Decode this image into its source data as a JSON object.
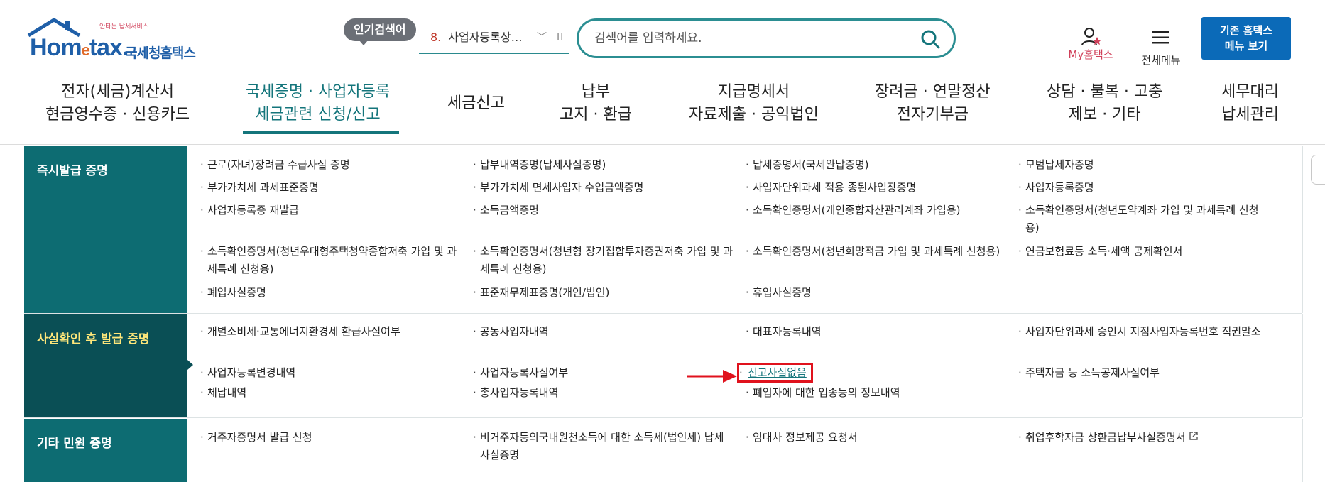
{
  "header": {
    "logo": {
      "text_en": "Hom",
      "text_e": "e",
      "text_tax": "tax.",
      "text_ko": "국세청홈택스",
      "tagline": "안타는 납세서비스"
    },
    "popular_search": {
      "badge": "인기검색어",
      "rank": "8.",
      "word": "사업자등록상…",
      "pause_icon": "II"
    },
    "search": {
      "placeholder": "검색어를 입력하세요."
    },
    "my_hometax": "My홈택스",
    "all_menu": "전체메뉴",
    "legacy_button": {
      "line1": "기존 홈택스",
      "line2": "메뉴 보기"
    }
  },
  "gnb": [
    {
      "line1": "전자(세금)계산서",
      "line2": "현금영수증 · 신용카드",
      "active": false
    },
    {
      "line1": "국세증명 · 사업자등록",
      "line2": "세금관련 신청/신고",
      "active": true
    },
    {
      "line1": "세금신고",
      "line2": "",
      "active": false
    },
    {
      "line1": "납부",
      "line2": "고지 · 환급",
      "active": false
    },
    {
      "line1": "지급명세서",
      "line2": "자료제출 · 공익법인",
      "active": false
    },
    {
      "line1": "장려금 · 연말정산",
      "line2": "전자기부금",
      "active": false
    },
    {
      "line1": "상담 · 불복 · 고충",
      "line2": "제보 · 기타",
      "active": false
    },
    {
      "line1": "세무대리",
      "line2": "납세관리",
      "active": false
    }
  ],
  "sections": [
    {
      "title": "즉시발급 증명",
      "items": [
        "근로(자녀)장려금 수급사실 증명",
        "납부내역증명(납세사실증명)",
        "납세증명서(국세완납증명)",
        "모범납세자증명",
        "부가가치세 과세표준증명",
        "부가가치세 면세사업자 수입금액증명",
        "사업자단위과세 적용 종된사업장증명",
        "사업자등록증명",
        "사업자등록증 재발급",
        "소득금액증명",
        "소득확인증명서(개인종합자산관리계좌 가입용)",
        "소득확인증명서(청년도약계좌 가입 및 과세특례 신청용)",
        "소득확인증명서(청년우대형주택청약종합저축 가입 및 과세특례 신청용)",
        "소득확인증명서(청년형 장기집합투자증권저축 가입 및 과세특례 신청용)",
        "소득확인증명서(청년희망적금 가입 및 과세특례 신청용)",
        "연금보험료등 소득·세액 공제확인서",
        "폐업사실증명",
        "표준재무제표증명(개인/법인)",
        "휴업사실증명"
      ]
    },
    {
      "title": "사실확인 후 발급 증명",
      "items": [
        "개별소비세·교통에너지환경세 환급사실여부",
        "공동사업자내역",
        "대표자등록내역",
        "사업자단위과세 승인시 지점사업자등록번호 직권말소",
        "사업자등록변경내역",
        "사업자등록사실여부",
        "신고사실없음",
        "주택자금 등 소득공제사실여부",
        "체납내역",
        "총사업자등록내역",
        "폐업자에 대한 업종등의 정보내역"
      ]
    },
    {
      "title": "기타 민원 증명",
      "items": [
        "거주자증명서 발급 신청",
        "비거주자등의국내원천소득에 대한 소득세(법인세) 납세사실증명",
        "임대차 정보제공 요청서",
        "취업후학자금 상환금납부사실증명서"
      ]
    }
  ],
  "colors": {
    "teal": "#0d6c72",
    "teal_dark": "#0a4f55",
    "highlight_text": "#ffe77a",
    "accent_red": "#e0121d",
    "brand_blue": "#1f5fa8",
    "legacy_btn": "#0b6ab8"
  }
}
